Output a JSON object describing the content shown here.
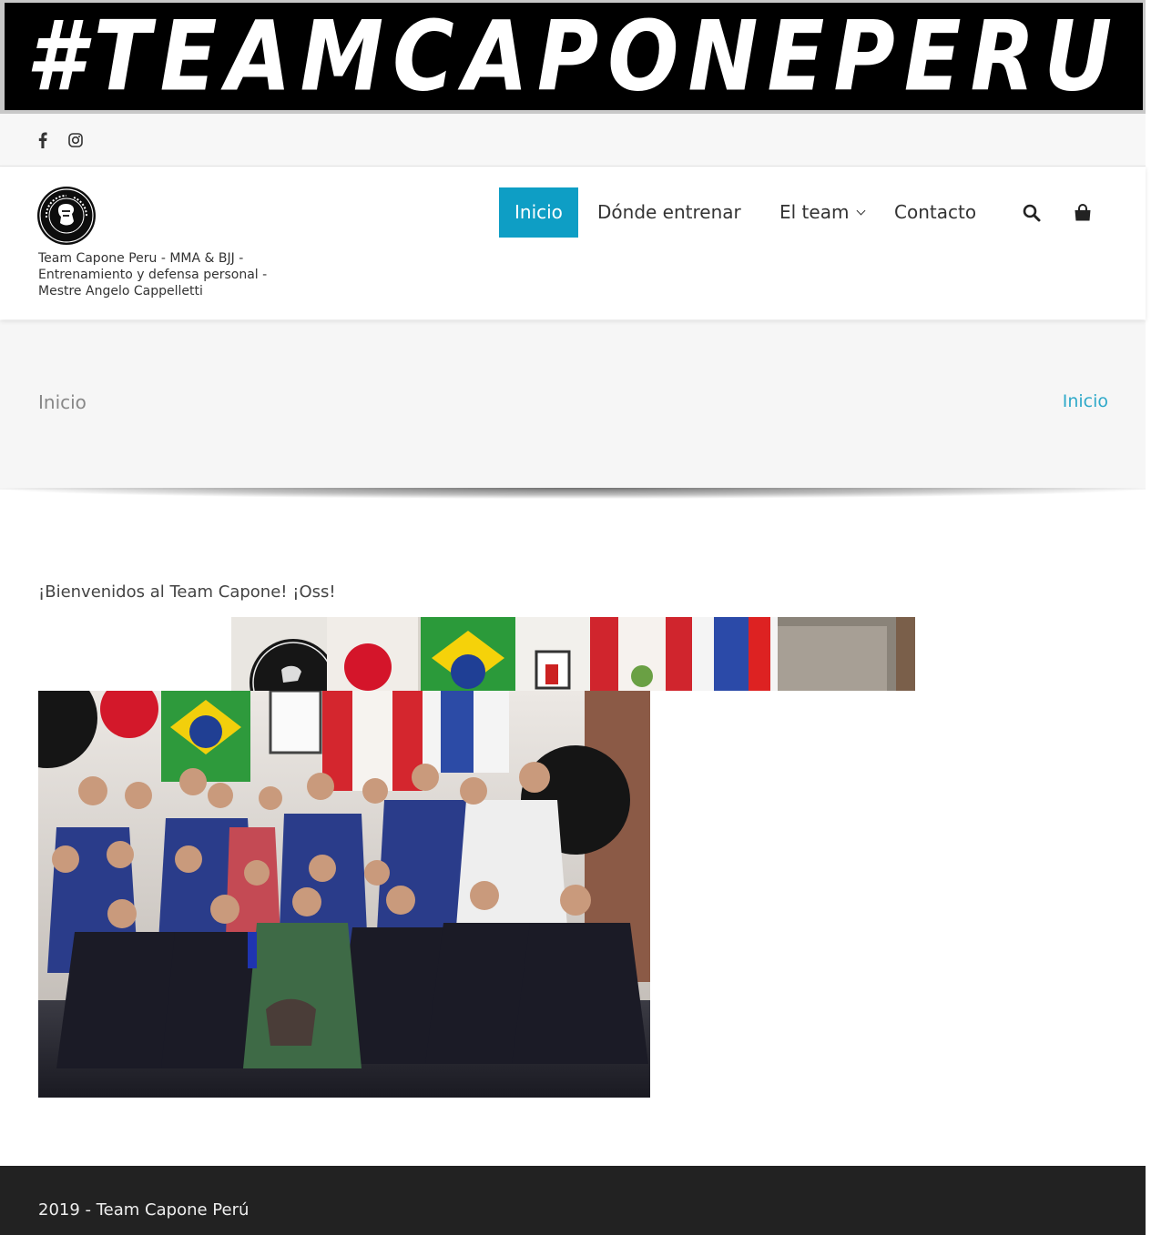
{
  "banner": {
    "text": "#TEAMCAPONEPERU"
  },
  "topbar": {
    "social": [
      "facebook-icon",
      "instagram-icon"
    ]
  },
  "header": {
    "logo_text": "CAPONE TEAM · BJJ & MMA",
    "tagline": "Team Capone Peru - MMA & BJJ - Entrenamiento y defensa personal - Mestre Angelo Cappelletti",
    "nav": [
      {
        "label": "Inicio",
        "active": true
      },
      {
        "label": "Dónde entrenar"
      },
      {
        "label": "El team",
        "has_dropdown": true
      },
      {
        "label": "Contacto"
      }
    ],
    "icons": [
      "search-icon",
      "shopping-bag-icon"
    ],
    "accent_color": "#0e9ec5"
  },
  "page_title": "Inicio",
  "breadcrumb": "Inicio",
  "content": {
    "welcome": "¡Bienvenidos al Team Capone! ¡Oss!"
  },
  "footer": {
    "text": "2019 - Team Capone Perú"
  }
}
